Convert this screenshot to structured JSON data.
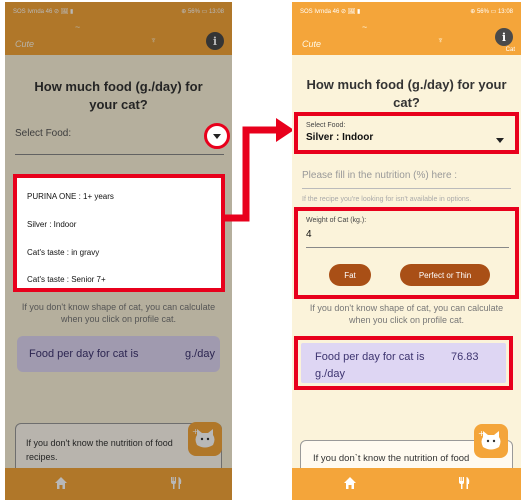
{
  "left": {
    "status": "SOS Ivrnda 46 ⊘ 🖼 ▮",
    "status_right": "⊕ 56% ▭ 13:08",
    "deco_text": "Cute",
    "info_glyph": "i",
    "heading": "How much food (g./day) for your cat?",
    "select_label": "Select Food:",
    "menu_items": [
      "PURINA ONE : 1+ years",
      "Silver : Indoor",
      "Cat's taste : in gravy",
      "Cat's taste : Senior 7+"
    ],
    "hint": "If you don't know shape of cat, you can calculate when you click on profile cat.",
    "result_label": "Food per day for cat is",
    "result_unit": "g./day",
    "card_text": "If you don't know the nutrition of food recipes."
  },
  "right": {
    "status": "SOS Ivrnda 46 ⊘ 🖼 ▮",
    "status_right": "⊕ 56% ▭ 13:08",
    "deco_text": "Cute",
    "info_glyph": "i",
    "cat_caption": "Cat",
    "heading": "How much food (g./day) for your cat?",
    "select_label": "Select Food:",
    "select_value": "Silver : Indoor",
    "nutrition_placeholder": "Please fill in the nutrition (%) here :",
    "nutrition_note": "If the recipe you're looking for isn't available in options.",
    "weight_label": "Weight of Cat (kg.):",
    "weight_value": "4",
    "btn_fat": "Fat",
    "btn_thin": "Perfect or Thin",
    "hint": "If you don't know shape of cat, you can calculate when you click on profile cat.",
    "result_label": "Food per day for cat is",
    "result_value": "76.83",
    "result_unit": "g./day",
    "card_text": "If you don`t know the nutrition of food"
  },
  "colors": {
    "accent": "#f4a53a",
    "highlight": "#e8001c",
    "button": "#a94f16",
    "result_bg": "#ded6f3",
    "background": "#fbf3da"
  },
  "icons": [
    "home-icon",
    "fork-knife-icon",
    "info-icon",
    "dropdown-arrow-icon",
    "add-cat-icon"
  ]
}
